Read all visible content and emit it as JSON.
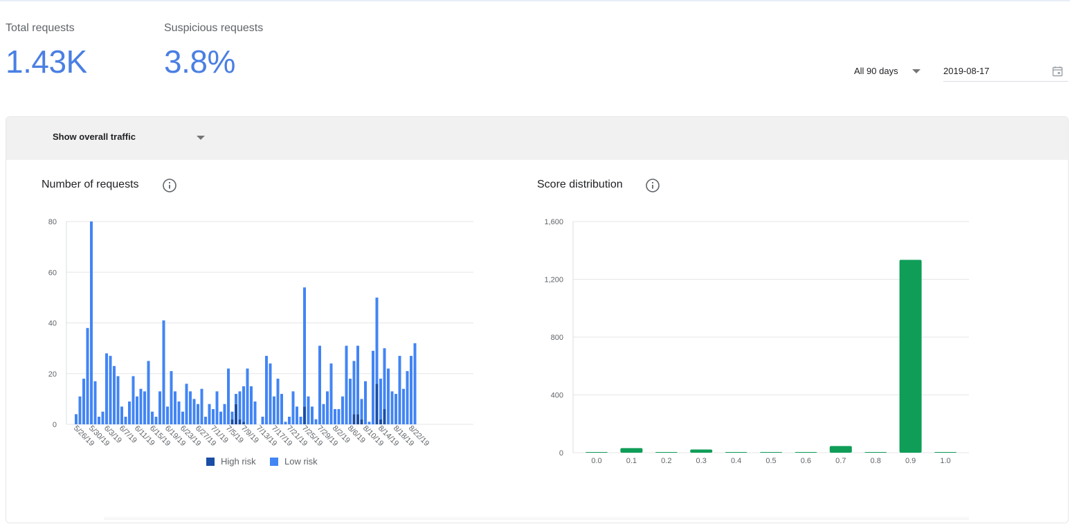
{
  "stats": {
    "total_label": "Total requests",
    "total_value": "1.43K",
    "suspicious_label": "Suspicious requests",
    "suspicious_value": "3.8%"
  },
  "filters": {
    "range_label": "All 90 days",
    "date_value": "2019-08-17",
    "calendar_icon": "calendar-icon"
  },
  "traffic_select": {
    "label": "Show overall traffic"
  },
  "colors": {
    "accent": "#4a7fe3",
    "high_risk": "#1a4ea5",
    "low_risk": "#4285f4",
    "score_bar": "#0f9d58"
  },
  "chart_data": [
    {
      "type": "bar",
      "title": "Number of requests",
      "info_icon": "info-icon",
      "stacked": true,
      "ylim": [
        0,
        80
      ],
      "yticks": [
        "0",
        "20",
        "40",
        "60",
        "80"
      ],
      "xtick_labels": [
        "5/26/19",
        "5/30/19",
        "6/3/19",
        "6/7/19",
        "6/11/19",
        "6/15/19",
        "6/19/19",
        "6/23/19",
        "6/27/19",
        "7/1/19",
        "7/5/19",
        "7/9/19",
        "7/13/19",
        "7/17/19",
        "7/21/19",
        "7/25/19",
        "7/29/19",
        "8/2/19",
        "8/6/19",
        "8/10/19",
        "8/14/19",
        "8/18/19",
        "8/22/19"
      ],
      "series": [
        {
          "name": "High risk",
          "color": "#1a4ea5",
          "values": [
            0,
            0,
            0,
            0,
            0,
            0,
            0,
            0,
            0,
            0,
            0,
            0,
            0,
            0,
            0,
            0,
            0,
            0,
            0,
            0,
            0,
            0,
            0,
            0,
            0,
            0,
            0,
            0,
            0,
            0,
            0,
            0,
            0,
            0,
            0,
            0,
            0,
            0,
            0,
            0,
            0,
            2,
            8,
            2,
            1,
            0,
            0,
            0,
            0,
            0,
            0,
            0,
            0,
            0,
            0,
            0,
            0,
            0,
            0,
            0,
            7,
            0,
            0,
            0,
            0,
            0,
            0,
            0,
            0,
            0,
            0,
            0,
            0,
            4,
            4,
            2,
            0,
            0,
            0,
            16,
            2,
            6,
            0,
            0,
            0,
            0,
            0,
            0,
            0,
            0,
            0,
            0
          ]
        },
        {
          "name": "Low risk",
          "color": "#4285f4",
          "values": [
            4,
            11,
            18,
            38,
            80,
            17,
            3,
            5,
            28,
            27,
            23,
            19,
            7,
            3,
            9,
            19,
            11,
            14,
            13,
            25,
            5,
            3,
            13,
            41,
            7,
            21,
            13,
            9,
            5,
            16,
            13,
            10,
            8,
            14,
            3,
            8,
            6,
            13,
            5,
            8,
            22,
            3,
            4,
            11,
            14,
            22,
            15,
            9,
            0,
            3,
            27,
            24,
            11,
            18,
            12,
            1,
            3,
            13,
            7,
            3,
            47,
            11,
            7,
            2,
            31,
            8,
            13,
            24,
            6,
            6,
            11,
            31,
            18,
            21,
            27,
            8,
            17,
            1,
            29,
            34,
            16,
            24,
            22,
            13,
            12,
            27,
            14,
            21,
            27,
            32,
            0,
            0
          ]
        }
      ]
    },
    {
      "type": "bar",
      "title": "Score distribution",
      "info_icon": "info-icon",
      "ylim": [
        0,
        1600
      ],
      "yticks": [
        "0",
        "400",
        "800",
        "1,200",
        "1,600"
      ],
      "categories": [
        "0.0",
        "0.1",
        "0.2",
        "0.3",
        "0.4",
        "0.5",
        "0.6",
        "0.7",
        "0.8",
        "0.9",
        "1.0"
      ],
      "values": [
        1,
        32,
        2,
        22,
        1,
        1,
        1,
        46,
        1,
        1335,
        2
      ],
      "color": "#0f9d58"
    }
  ],
  "legend": {
    "high_risk": "High risk",
    "low_risk": "Low risk"
  }
}
